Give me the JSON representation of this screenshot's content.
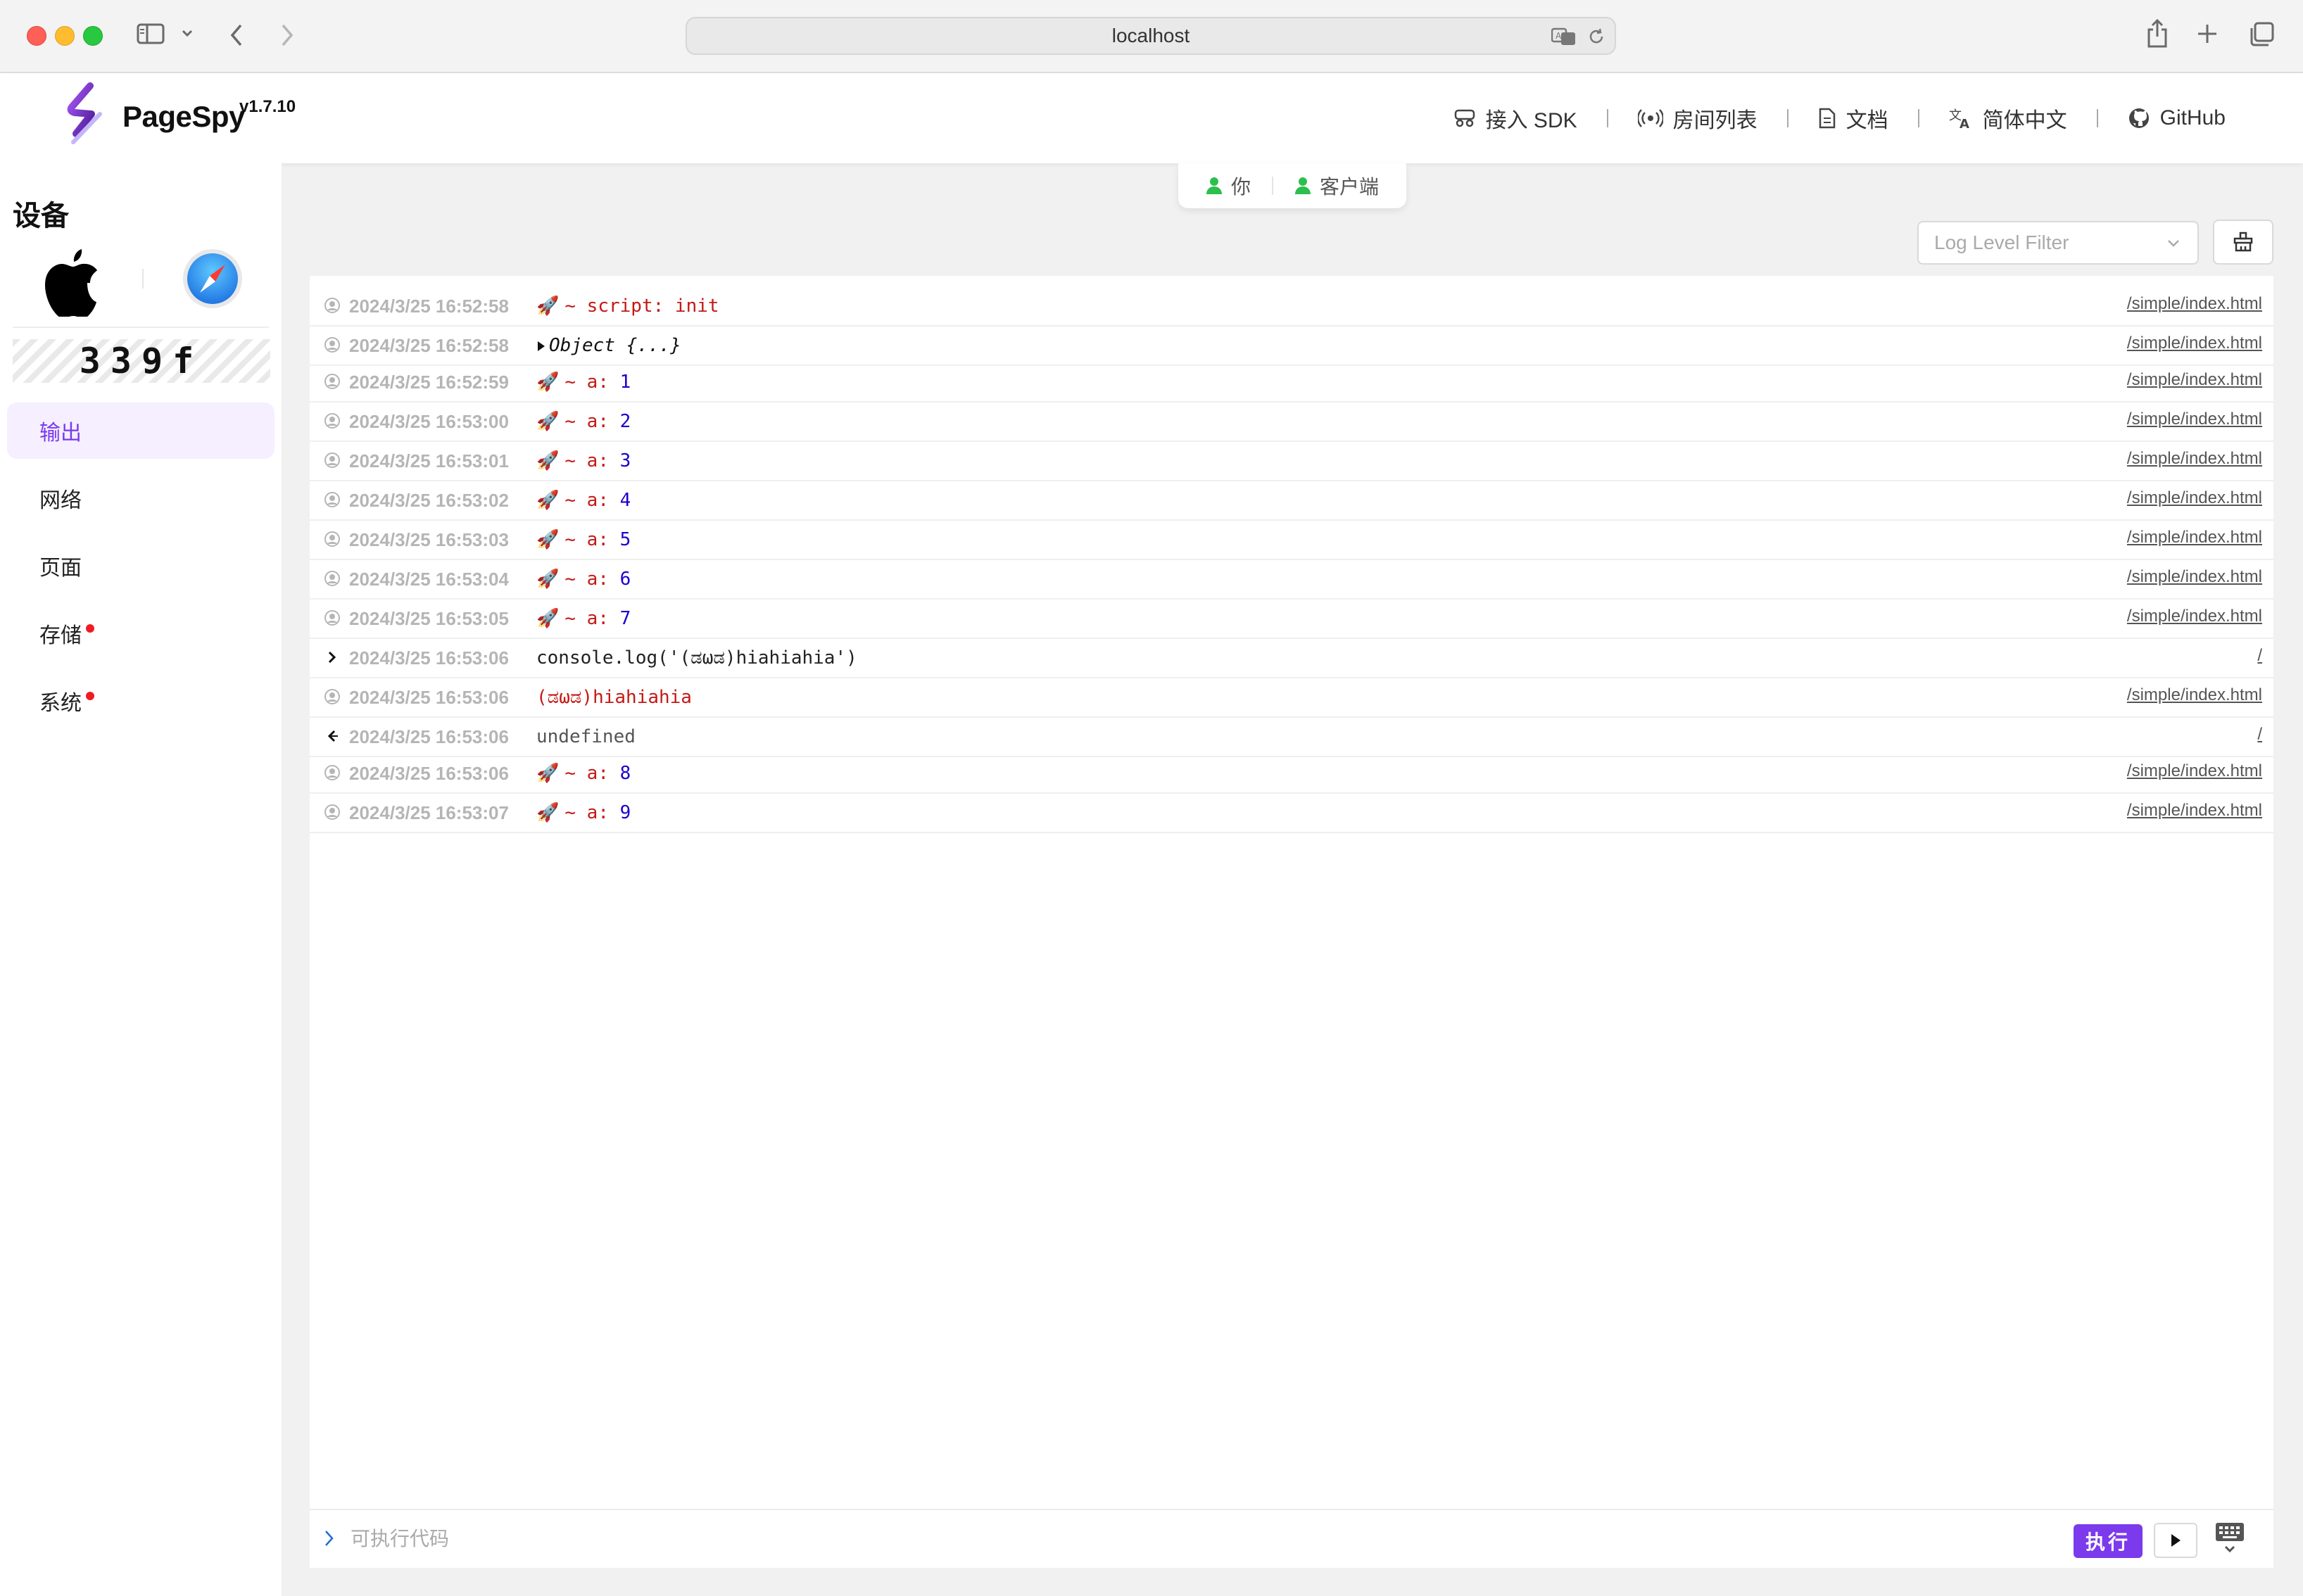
{
  "browser": {
    "url": "localhost"
  },
  "header": {
    "brand": "PageSpy",
    "version": "v1.7.10",
    "nav": [
      {
        "label": "接入 SDK",
        "icon": "sdk-icon"
      },
      {
        "label": "房间列表",
        "icon": "broadcast-icon"
      },
      {
        "label": "文档",
        "icon": "document-icon"
      },
      {
        "label": "简体中文",
        "icon": "translate-icon"
      },
      {
        "label": "GitHub",
        "icon": "github-icon"
      }
    ]
  },
  "sidebar": {
    "title": "设备",
    "device_code": "339f",
    "items": [
      {
        "label": "输出",
        "active": true,
        "dot": false
      },
      {
        "label": "网络",
        "active": false,
        "dot": false
      },
      {
        "label": "页面",
        "active": false,
        "dot": false
      },
      {
        "label": "存储",
        "active": false,
        "dot": true
      },
      {
        "label": "系统",
        "active": false,
        "dot": true
      }
    ]
  },
  "roles": {
    "you": "你",
    "client": "客户端"
  },
  "toolbar": {
    "log_level_placeholder": "Log Level Filter"
  },
  "logs": [
    {
      "type": "log",
      "time": "2024/3/25 16:52:58",
      "rocket": "🚀",
      "key": "~ script:",
      "val": "init",
      "src": "/simple/index.html"
    },
    {
      "type": "object",
      "time": "2024/3/25 16:52:58",
      "text": "Object {...}",
      "src": "/simple/index.html"
    },
    {
      "type": "log",
      "time": "2024/3/25 16:52:59",
      "rocket": "🚀",
      "key": "~ a:",
      "val": "1",
      "src": "/simple/index.html"
    },
    {
      "type": "log",
      "time": "2024/3/25 16:53:00",
      "rocket": "🚀",
      "key": "~ a:",
      "val": "2",
      "src": "/simple/index.html"
    },
    {
      "type": "log",
      "time": "2024/3/25 16:53:01",
      "rocket": "🚀",
      "key": "~ a:",
      "val": "3",
      "src": "/simple/index.html"
    },
    {
      "type": "log",
      "time": "2024/3/25 16:53:02",
      "rocket": "🚀",
      "key": "~ a:",
      "val": "4",
      "src": "/simple/index.html"
    },
    {
      "type": "log",
      "time": "2024/3/25 16:53:03",
      "rocket": "🚀",
      "key": "~ a:",
      "val": "5",
      "src": "/simple/index.html"
    },
    {
      "type": "log",
      "time": "2024/3/25 16:53:04",
      "rocket": "🚀",
      "key": "~ a:",
      "val": "6",
      "src": "/simple/index.html"
    },
    {
      "type": "log",
      "time": "2024/3/25 16:53:05",
      "rocket": "🚀",
      "key": "~ a:",
      "val": "7",
      "src": "/simple/index.html"
    },
    {
      "type": "input",
      "time": "2024/3/25 16:53:06",
      "text": "console.log('(ಡωಡ)hiahiahia')",
      "src": "/"
    },
    {
      "type": "plain-red",
      "time": "2024/3/25 16:53:06",
      "text": "(ಡωಡ)hiahiahia",
      "src": "/simple/index.html"
    },
    {
      "type": "output",
      "time": "2024/3/25 16:53:06",
      "text": "undefined",
      "src": "/"
    },
    {
      "type": "log",
      "time": "2024/3/25 16:53:06",
      "rocket": "🚀",
      "key": "~ a:",
      "val": "8",
      "src": "/simple/index.html"
    },
    {
      "type": "log",
      "time": "2024/3/25 16:53:07",
      "rocket": "🚀",
      "key": "~ a:",
      "val": "9",
      "src": "/simple/index.html"
    }
  ],
  "console_input": {
    "placeholder": "可执行代码",
    "run_label": "执行"
  },
  "colors": {
    "accent": "#7c3aed",
    "log_red": "#c41a16",
    "log_blue": "#1c00cf",
    "online": "#2cbf4e"
  }
}
